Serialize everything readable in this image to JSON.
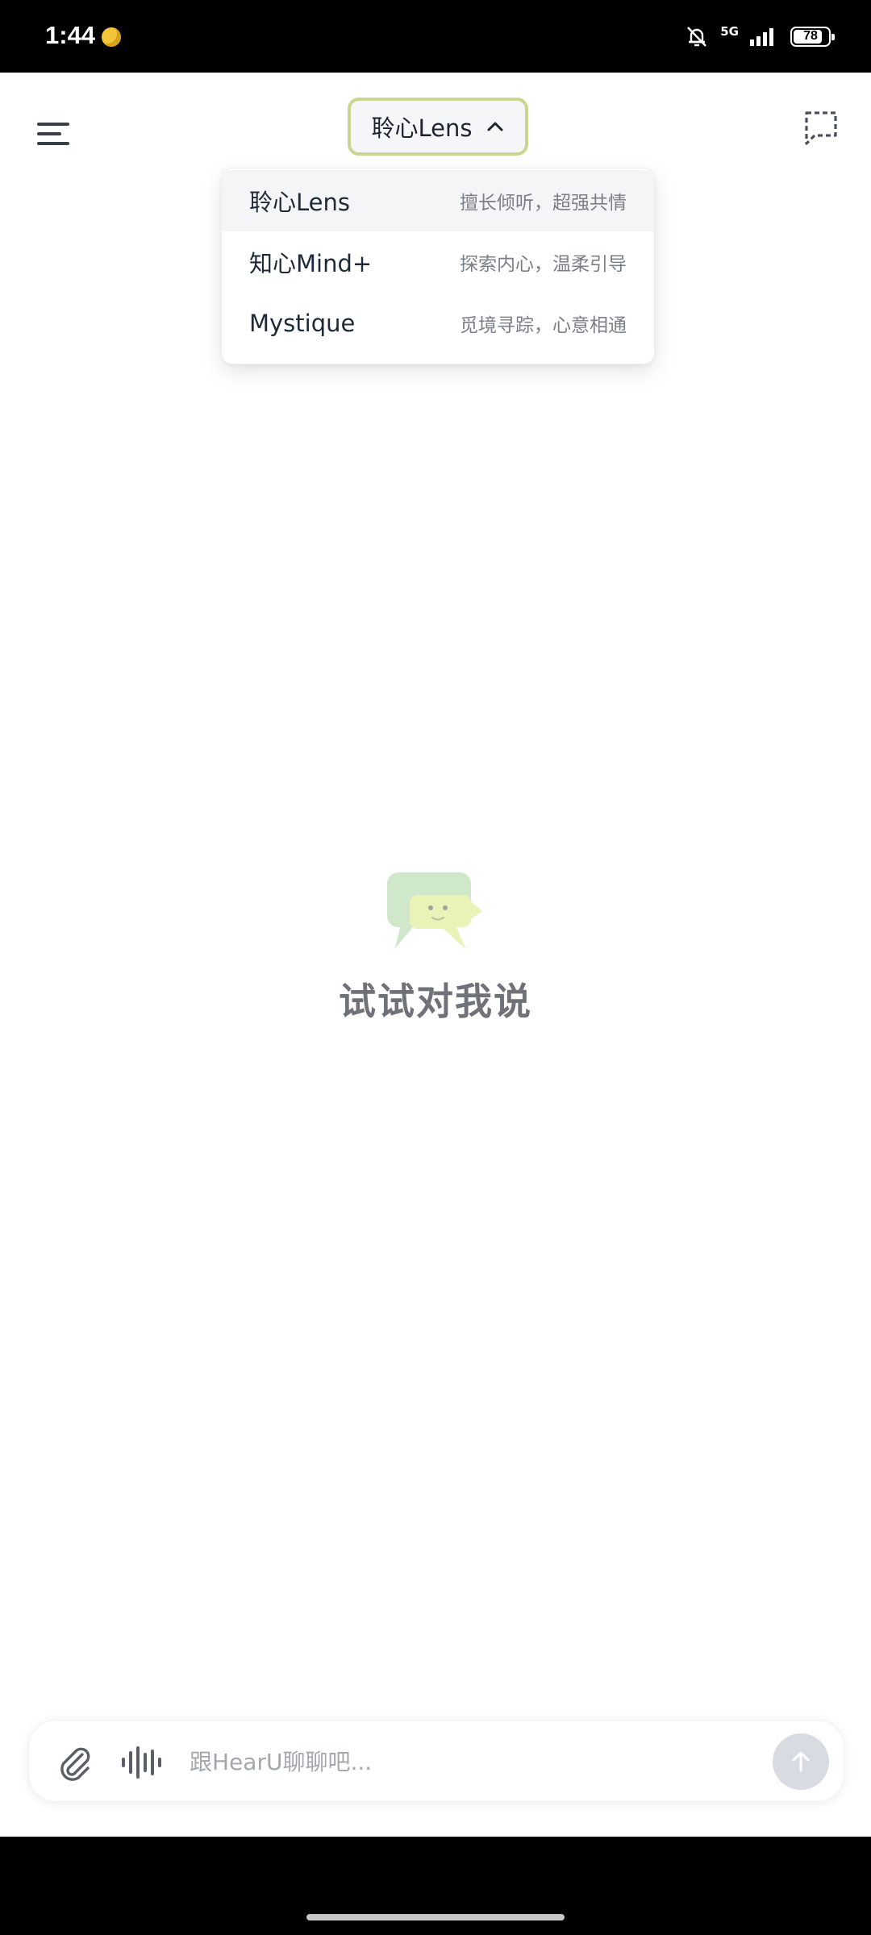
{
  "status": {
    "time": "1:44",
    "network": "5G",
    "battery": "78"
  },
  "header": {
    "selected_model": "聆心Lens"
  },
  "dropdown": {
    "items": [
      {
        "name": "聆心Lens",
        "desc": "擅长倾听，超强共情"
      },
      {
        "name": "知心Mind+",
        "desc": "探索内心，温柔引导"
      },
      {
        "name": "Mystique",
        "desc": "觅境寻踪，心意相通"
      }
    ]
  },
  "empty_state": {
    "text": "试试对我说"
  },
  "input": {
    "placeholder": "跟HearU聊聊吧..."
  },
  "colors": {
    "accent": "#c7d78e",
    "mascot_green": "#cfe8c9",
    "mascot_yellow": "#e9f3b8",
    "send_disabled": "#d8dbe1"
  }
}
